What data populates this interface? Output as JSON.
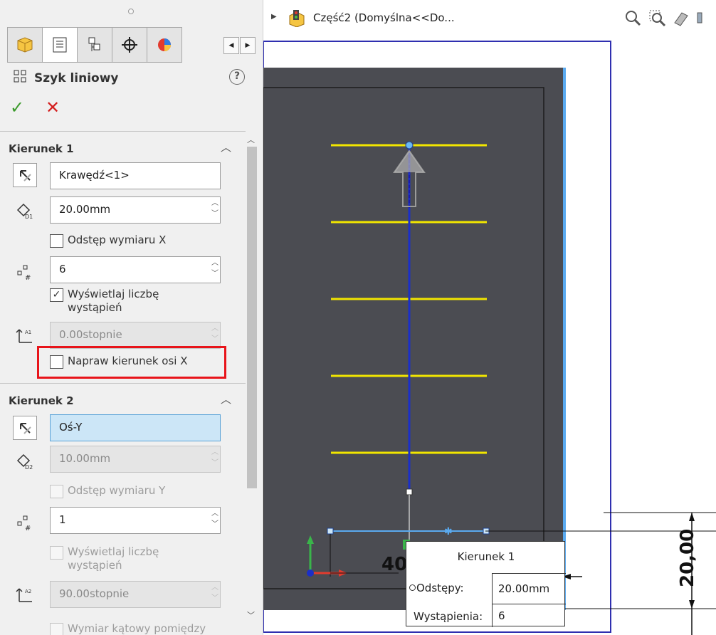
{
  "breadcrumb": {
    "text": "Część2  (Domyślna<<Do..."
  },
  "property_manager": {
    "title": "Szyk liniowy",
    "help": "?",
    "ok": "✓",
    "cancel": "✕"
  },
  "direction1": {
    "title": "Kierunek 1",
    "reference": "Krawędź<1>",
    "spacing": "20.00mm",
    "dim_spacing_label": "Odstęp wymiaru X",
    "instances": "6",
    "show_count_label": "Wyświetlaj liczbę wystąpień",
    "show_count_checked": true,
    "angle": "0.00stopnie",
    "fix_axis_label": "Napraw kierunek osi X",
    "fix_axis_checked": false
  },
  "direction2": {
    "title": "Kierunek 2",
    "reference": "Oś-Y",
    "spacing": "10.00mm",
    "dim_spacing_label": "Odstęp wymiaru Y",
    "instances": "1",
    "show_count_label": "Wyświetlaj liczbę wystąpień",
    "angle": "90.00stopnie",
    "angular_label": "Wymiar kątowy pomiędzy"
  },
  "callout": {
    "title": "Kierunek 1",
    "spacing_label": "Odstępy:",
    "spacing_value": "20.00mm",
    "instances_label": "Wystąpienia:",
    "instances_value": "6"
  },
  "dimensions": {
    "horizontal": "40,",
    "vertical": "20,00"
  },
  "colors": {
    "model_face": "#4b4c52",
    "pattern_line": "#f2e600",
    "direction_line": "#1b2fc8",
    "highlight": "#e8141a"
  },
  "pattern": {
    "line_count": 5
  }
}
